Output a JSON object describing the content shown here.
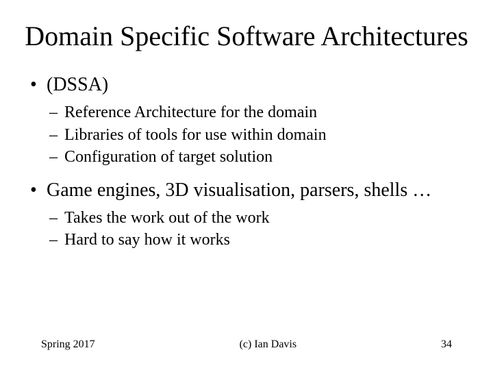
{
  "title": "Domain Specific Software Architectures",
  "bullets": [
    {
      "text": "(DSSA)",
      "subs": [
        "Reference Architecture for the domain",
        "Libraries of tools for use within domain",
        "Configuration of target solution"
      ]
    },
    {
      "text": "Game engines, 3D visualisation, parsers, shells …",
      "subs": [
        "Takes the work out of the work",
        "Hard to say how it works"
      ]
    }
  ],
  "footer": {
    "left": "Spring 2017",
    "center": "(c) Ian Davis",
    "right": "34"
  }
}
